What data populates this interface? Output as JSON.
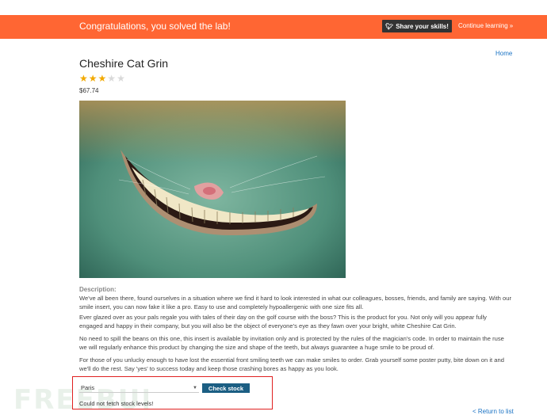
{
  "banner": {
    "message": "Congratulations, you solved the lab!",
    "share_label": "Share your skills!",
    "continue_label": "Continue learning",
    "color": "#ff6633"
  },
  "nav": {
    "home_label": "Home",
    "return_label": "< Return to list"
  },
  "product": {
    "title": "Cheshire Cat Grin",
    "rating": {
      "value": 3,
      "max": 5
    },
    "price": "$67.74",
    "description_label": "Description:",
    "description": [
      "We've all been there, found ourselves in a situation where we find it hard to look interested in what our colleagues, bosses, friends, and family are saying. With our smile insert, you can now fake it like a pro. Easy to use and completely hypoallergenic with one size fits all.",
      "Ever glazed over as your pals regale you with tales of their day on the golf course with the boss? This is the product for you. Not only will you appear fully engaged and happy in their company, but you will also be the object of everyone's eye as they fawn over your bright, white Cheshire Cat Grin.",
      "No need to spill the beans on this one, this insert is available by invitation only and is protected by the rules of the magician's code. In order to maintain the ruse we will regularly enhance this product by changing the size and shape of the teeth, but always guarantee a huge smile to be proud of.",
      "For those of you unlucky enough to have lost the essential front smiling teeth we can make smiles to order. Grab yourself some poster putty, bite down on it and we'll do the rest. Say 'yes' to success today and keep those crashing bores as happy as you look."
    ]
  },
  "stock": {
    "selected_store": "Paris",
    "button_label": "Check stock",
    "message": "Could not fetch stock levels!"
  },
  "watermark": {
    "text": "FREEBUF"
  },
  "icons": {
    "twitter": "twitter-icon",
    "chevron": "double-chevron-right-icon",
    "dropdown": "chevron-down-icon",
    "star": "star-icon"
  },
  "colors": {
    "link": "#1a73c4",
    "button": "#1b5e83",
    "highlight_box": "#e02020",
    "star_on": "#f2a900",
    "star_off": "#d9d9d9"
  }
}
